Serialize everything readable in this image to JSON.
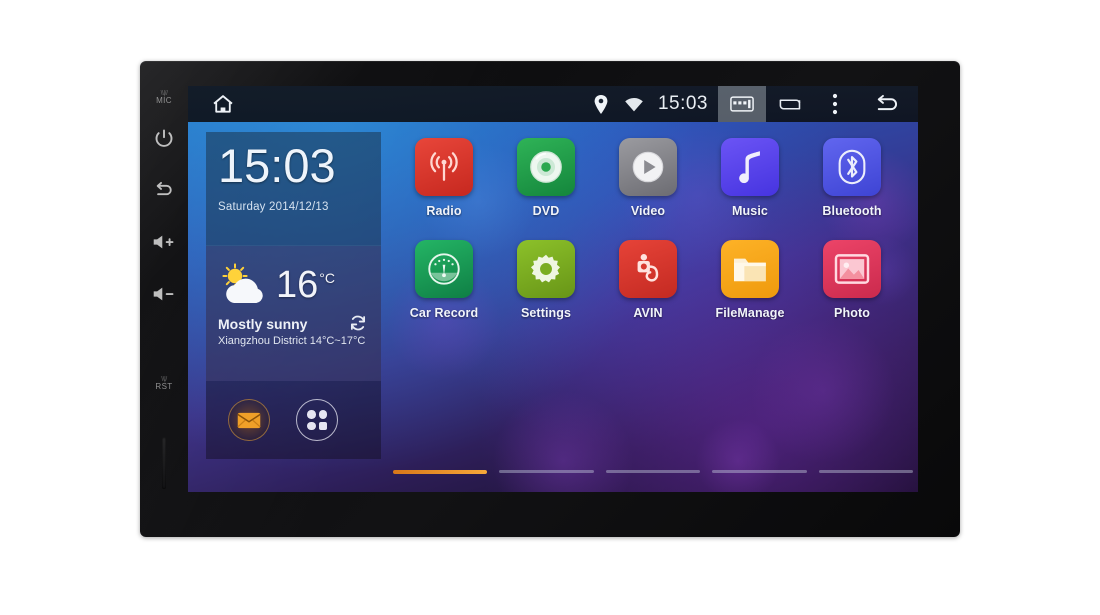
{
  "device": {
    "bezel_buttons": [
      {
        "name": "mic",
        "label": "MIC",
        "squiggle": "\\\\|//"
      },
      {
        "name": "power",
        "label": ""
      },
      {
        "name": "back",
        "label": ""
      },
      {
        "name": "volume-up",
        "label": ""
      },
      {
        "name": "volume-down",
        "label": ""
      },
      {
        "name": "reset",
        "label": "RST",
        "squiggle": "\\\\|/"
      }
    ]
  },
  "statusbar": {
    "home_icon": "home-icon",
    "location_icon": "location-pin-icon",
    "wifi_icon": "wifi-icon",
    "clock": "15:03",
    "capture_icon": "screen-capture-icon",
    "recents_icon": "recent-apps-icon",
    "overflow_icon": "overflow-menu-icon",
    "back_icon": "back-arrow-icon"
  },
  "clock_widget": {
    "time": "15:03",
    "date": "Saturday 2014/12/13"
  },
  "weather_widget": {
    "icon": "sun-behind-cloud-icon",
    "temperature": "16",
    "unit": "°C",
    "condition": "Mostly sunny",
    "location_range": "Xiangzhou District 14°C~17°C",
    "refresh_icon": "refresh-icon"
  },
  "dock": {
    "items": [
      {
        "name": "messages",
        "icon": "envelope-icon",
        "color": "#e8a43c"
      },
      {
        "name": "app-drawer",
        "icon": "app-drawer-icon",
        "color": "#e6e6f2"
      }
    ]
  },
  "apps": [
    {
      "label": "Radio",
      "icon": "radio-broadcast-icon",
      "color": "#e03a2f",
      "color2": "#c22a22"
    },
    {
      "label": "DVD",
      "icon": "disc-icon",
      "color": "#21a34a",
      "color2": "#17853a"
    },
    {
      "label": "Video",
      "icon": "play-circle-icon",
      "color": "#8d8d92",
      "color2": "#6f6f75"
    },
    {
      "label": "Music",
      "icon": "music-note-icon",
      "color": "#5b45ef",
      "color2": "#4a35dd"
    },
    {
      "label": "Bluetooth",
      "icon": "bluetooth-icon",
      "color": "#5358e8",
      "color2": "#4045d6"
    },
    {
      "label": "Car Record",
      "icon": "dashcam-gauge-icon",
      "color": "#1ba05a",
      "color2": "#13834a"
    },
    {
      "label": "Settings",
      "icon": "gear-icon",
      "color": "#7fb024",
      "color2": "#6a951c"
    },
    {
      "label": "AVIN",
      "icon": "camera-input-icon",
      "color": "#e0392f",
      "color2": "#c62b23"
    },
    {
      "label": "FileManage",
      "icon": "folder-icon",
      "color": "#f5a81c",
      "color2": "#e09410"
    },
    {
      "label": "Photo",
      "icon": "picture-icon",
      "color": "#e0395e",
      "color2": "#c92a4e"
    }
  ],
  "page_indicator": {
    "count": 5,
    "active_index": 0,
    "active_color": "#e08a1e"
  }
}
